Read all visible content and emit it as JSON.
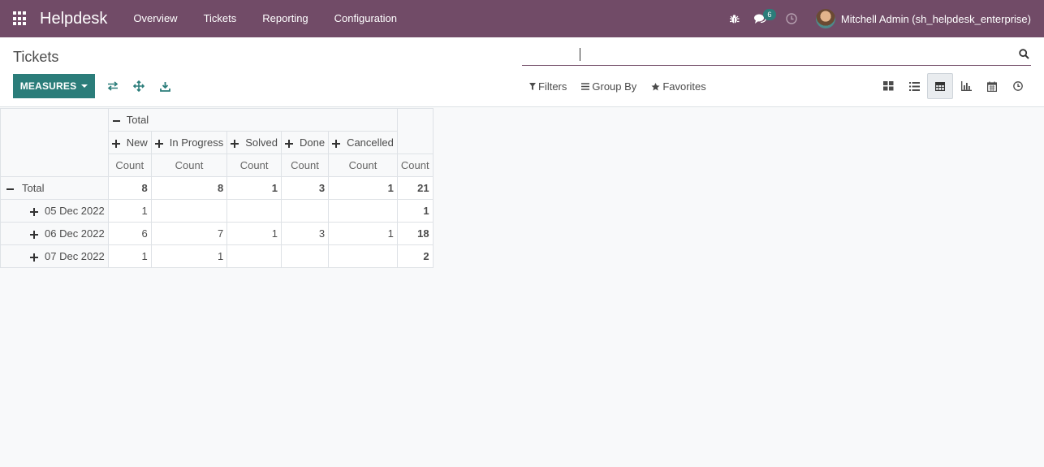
{
  "navbar": {
    "app_name": "Helpdesk",
    "menu": [
      "Overview",
      "Tickets",
      "Reporting",
      "Configuration"
    ],
    "chat_count": "6",
    "user_name": "Mitchell Admin (sh_helpdesk_enterprise)",
    "brand_color": "#714b67"
  },
  "control_panel": {
    "title": "Tickets",
    "search_placeholder": "",
    "measures_label": "MEASURES",
    "filters_label": "Filters",
    "group_by_label": "Group By",
    "favorites_label": "Favorites",
    "accent_color": "#2b7d7a",
    "views": [
      "kanban-icon",
      "list-icon",
      "pivot-icon",
      "graph-icon",
      "calendar-icon",
      "activity-icon"
    ],
    "active_view": "pivot-icon"
  },
  "pivot": {
    "col_group_label": "Total",
    "col_headers": [
      "New",
      "In Progress",
      "Solved",
      "Done",
      "Cancelled"
    ],
    "measure_label": "Count",
    "total_row": {
      "label": "Total",
      "values": [
        "8",
        "8",
        "1",
        "3",
        "1",
        "21"
      ]
    },
    "rows": [
      {
        "label": "05 Dec 2022",
        "values": [
          "1",
          "",
          "",
          "",
          "",
          "1"
        ]
      },
      {
        "label": "06 Dec 2022",
        "values": [
          "6",
          "7",
          "1",
          "3",
          "1",
          "18"
        ]
      },
      {
        "label": "07 Dec 2022",
        "values": [
          "1",
          "1",
          "",
          "",
          "",
          "2"
        ]
      }
    ]
  }
}
